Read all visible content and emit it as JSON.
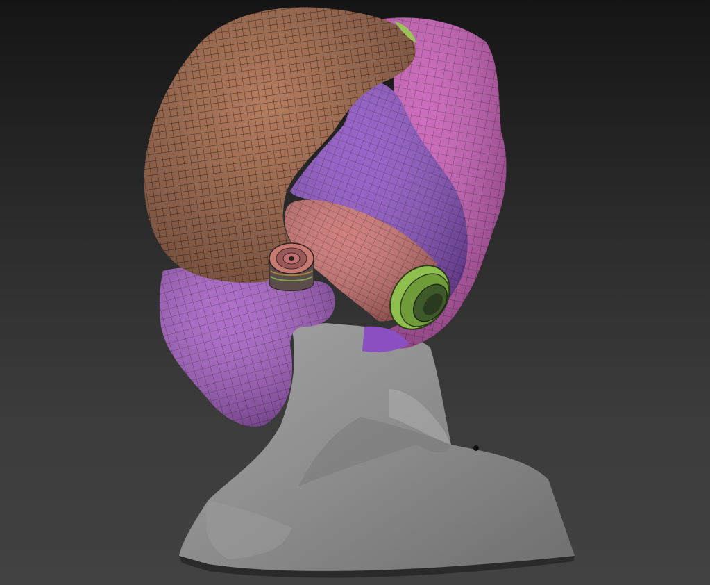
{
  "scene": {
    "subject": "sculpted-head-bust-with-polygroups",
    "colors": {
      "background_top": "#151515",
      "background_bottom": "#424242",
      "bust_gray": "#8f8f8f",
      "cranium_tan": "#b07a5e",
      "mask_violet": "#8a4fc0",
      "jaw_purple": "#a15ac0",
      "face_magenta": "#c258b0",
      "tube_coral": "#c76d6a",
      "ring_green": "#9ac258",
      "wire": "#3a2a2a"
    }
  }
}
